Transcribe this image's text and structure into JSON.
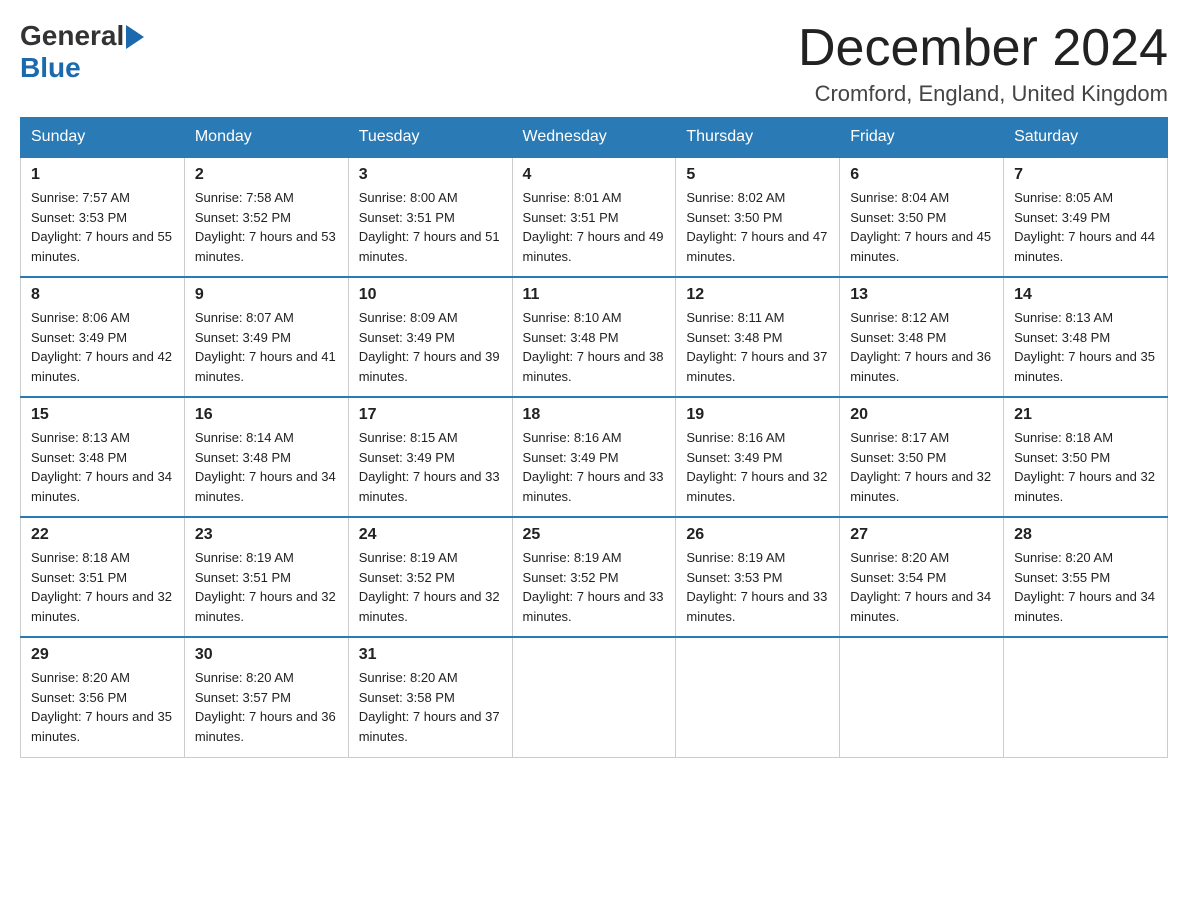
{
  "header": {
    "logo_general": "General",
    "logo_blue": "Blue",
    "month_title": "December 2024",
    "subtitle": "Cromford, England, United Kingdom"
  },
  "days_of_week": [
    "Sunday",
    "Monday",
    "Tuesday",
    "Wednesday",
    "Thursday",
    "Friday",
    "Saturday"
  ],
  "weeks": [
    [
      {
        "day": "1",
        "sunrise": "7:57 AM",
        "sunset": "3:53 PM",
        "daylight": "7 hours and 55 minutes."
      },
      {
        "day": "2",
        "sunrise": "7:58 AM",
        "sunset": "3:52 PM",
        "daylight": "7 hours and 53 minutes."
      },
      {
        "day": "3",
        "sunrise": "8:00 AM",
        "sunset": "3:51 PM",
        "daylight": "7 hours and 51 minutes."
      },
      {
        "day": "4",
        "sunrise": "8:01 AM",
        "sunset": "3:51 PM",
        "daylight": "7 hours and 49 minutes."
      },
      {
        "day": "5",
        "sunrise": "8:02 AM",
        "sunset": "3:50 PM",
        "daylight": "7 hours and 47 minutes."
      },
      {
        "day": "6",
        "sunrise": "8:04 AM",
        "sunset": "3:50 PM",
        "daylight": "7 hours and 45 minutes."
      },
      {
        "day": "7",
        "sunrise": "8:05 AM",
        "sunset": "3:49 PM",
        "daylight": "7 hours and 44 minutes."
      }
    ],
    [
      {
        "day": "8",
        "sunrise": "8:06 AM",
        "sunset": "3:49 PM",
        "daylight": "7 hours and 42 minutes."
      },
      {
        "day": "9",
        "sunrise": "8:07 AM",
        "sunset": "3:49 PM",
        "daylight": "7 hours and 41 minutes."
      },
      {
        "day": "10",
        "sunrise": "8:09 AM",
        "sunset": "3:49 PM",
        "daylight": "7 hours and 39 minutes."
      },
      {
        "day": "11",
        "sunrise": "8:10 AM",
        "sunset": "3:48 PM",
        "daylight": "7 hours and 38 minutes."
      },
      {
        "day": "12",
        "sunrise": "8:11 AM",
        "sunset": "3:48 PM",
        "daylight": "7 hours and 37 minutes."
      },
      {
        "day": "13",
        "sunrise": "8:12 AM",
        "sunset": "3:48 PM",
        "daylight": "7 hours and 36 minutes."
      },
      {
        "day": "14",
        "sunrise": "8:13 AM",
        "sunset": "3:48 PM",
        "daylight": "7 hours and 35 minutes."
      }
    ],
    [
      {
        "day": "15",
        "sunrise": "8:13 AM",
        "sunset": "3:48 PM",
        "daylight": "7 hours and 34 minutes."
      },
      {
        "day": "16",
        "sunrise": "8:14 AM",
        "sunset": "3:48 PM",
        "daylight": "7 hours and 34 minutes."
      },
      {
        "day": "17",
        "sunrise": "8:15 AM",
        "sunset": "3:49 PM",
        "daylight": "7 hours and 33 minutes."
      },
      {
        "day": "18",
        "sunrise": "8:16 AM",
        "sunset": "3:49 PM",
        "daylight": "7 hours and 33 minutes."
      },
      {
        "day": "19",
        "sunrise": "8:16 AM",
        "sunset": "3:49 PM",
        "daylight": "7 hours and 32 minutes."
      },
      {
        "day": "20",
        "sunrise": "8:17 AM",
        "sunset": "3:50 PM",
        "daylight": "7 hours and 32 minutes."
      },
      {
        "day": "21",
        "sunrise": "8:18 AM",
        "sunset": "3:50 PM",
        "daylight": "7 hours and 32 minutes."
      }
    ],
    [
      {
        "day": "22",
        "sunrise": "8:18 AM",
        "sunset": "3:51 PM",
        "daylight": "7 hours and 32 minutes."
      },
      {
        "day": "23",
        "sunrise": "8:19 AM",
        "sunset": "3:51 PM",
        "daylight": "7 hours and 32 minutes."
      },
      {
        "day": "24",
        "sunrise": "8:19 AM",
        "sunset": "3:52 PM",
        "daylight": "7 hours and 32 minutes."
      },
      {
        "day": "25",
        "sunrise": "8:19 AM",
        "sunset": "3:52 PM",
        "daylight": "7 hours and 33 minutes."
      },
      {
        "day": "26",
        "sunrise": "8:19 AM",
        "sunset": "3:53 PM",
        "daylight": "7 hours and 33 minutes."
      },
      {
        "day": "27",
        "sunrise": "8:20 AM",
        "sunset": "3:54 PM",
        "daylight": "7 hours and 34 minutes."
      },
      {
        "day": "28",
        "sunrise": "8:20 AM",
        "sunset": "3:55 PM",
        "daylight": "7 hours and 34 minutes."
      }
    ],
    [
      {
        "day": "29",
        "sunrise": "8:20 AM",
        "sunset": "3:56 PM",
        "daylight": "7 hours and 35 minutes."
      },
      {
        "day": "30",
        "sunrise": "8:20 AM",
        "sunset": "3:57 PM",
        "daylight": "7 hours and 36 minutes."
      },
      {
        "day": "31",
        "sunrise": "8:20 AM",
        "sunset": "3:58 PM",
        "daylight": "7 hours and 37 minutes."
      },
      null,
      null,
      null,
      null
    ]
  ]
}
